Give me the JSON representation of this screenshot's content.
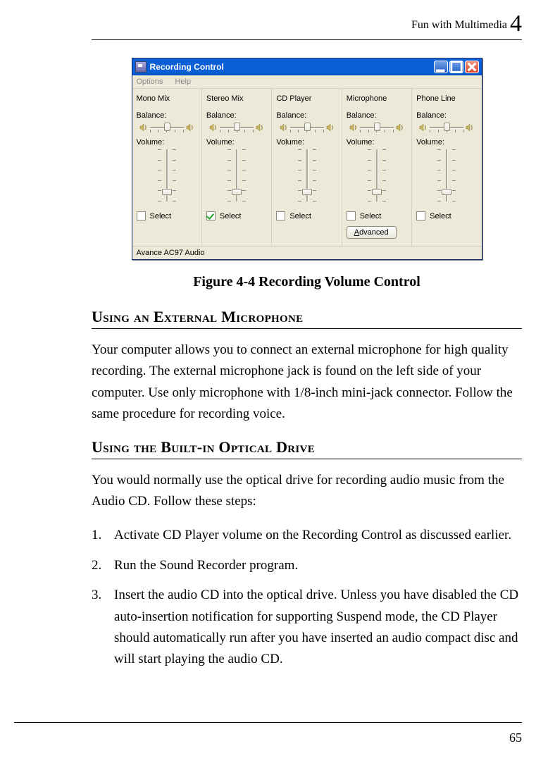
{
  "header": {
    "title": "Fun with Multimedia",
    "chapter": "4"
  },
  "figure": {
    "window_title": "Recording Control",
    "menu": {
      "options": "Options",
      "help": "Help"
    },
    "caption": "Figure 4-4 Recording Volume Control",
    "channels": [
      {
        "name": "Mono Mix",
        "balance_label": "Balance:",
        "volume_label": "Volume:",
        "select_label": "Select",
        "checked": false,
        "hpos": 20,
        "vpos": 58,
        "advanced": false
      },
      {
        "name": "Stereo Mix",
        "balance_label": "Balance:",
        "volume_label": "Volume:",
        "select_label": "Select",
        "checked": true,
        "hpos": 20,
        "vpos": 58,
        "advanced": false
      },
      {
        "name": "CD Player",
        "balance_label": "Balance:",
        "volume_label": "Volume:",
        "select_label": "Select",
        "checked": false,
        "hpos": 20,
        "vpos": 58,
        "advanced": false
      },
      {
        "name": "Microphone",
        "balance_label": "Balance:",
        "volume_label": "Volume:",
        "select_label": "Select",
        "checked": false,
        "hpos": 20,
        "vpos": 58,
        "advanced": true,
        "advanced_label": "Advanced"
      },
      {
        "name": "Phone Line",
        "balance_label": "Balance:",
        "volume_label": "Volume:",
        "select_label": "Select",
        "checked": false,
        "hpos": 20,
        "vpos": 58,
        "advanced": false
      }
    ],
    "status": "Avance AC97 Audio"
  },
  "sections": [
    {
      "heading_html": "Using an External Microphone",
      "body": "Your computer allows you to connect an external microphone for high quality recording. The external microphone jack is found on the left side of your computer. Use only microphone with 1/8-inch mini-jack connector. Follow the same procedure for recording voice."
    },
    {
      "heading_html": "Using the Built-in Optical Drive",
      "body": "You would normally use the optical drive for recording audio music from the Audio CD. Follow these steps:",
      "list": [
        "Activate CD Player volume on the Recording Control as discussed earlier.",
        "Run the Sound Recorder program.",
        "Insert the audio CD into the optical drive. Unless you have disabled the CD auto-insertion notification for supporting Suspend mode, the CD Player should automatically run after you have inserted an audio compact disc and will start playing the audio CD."
      ]
    }
  ],
  "page_number": "65"
}
